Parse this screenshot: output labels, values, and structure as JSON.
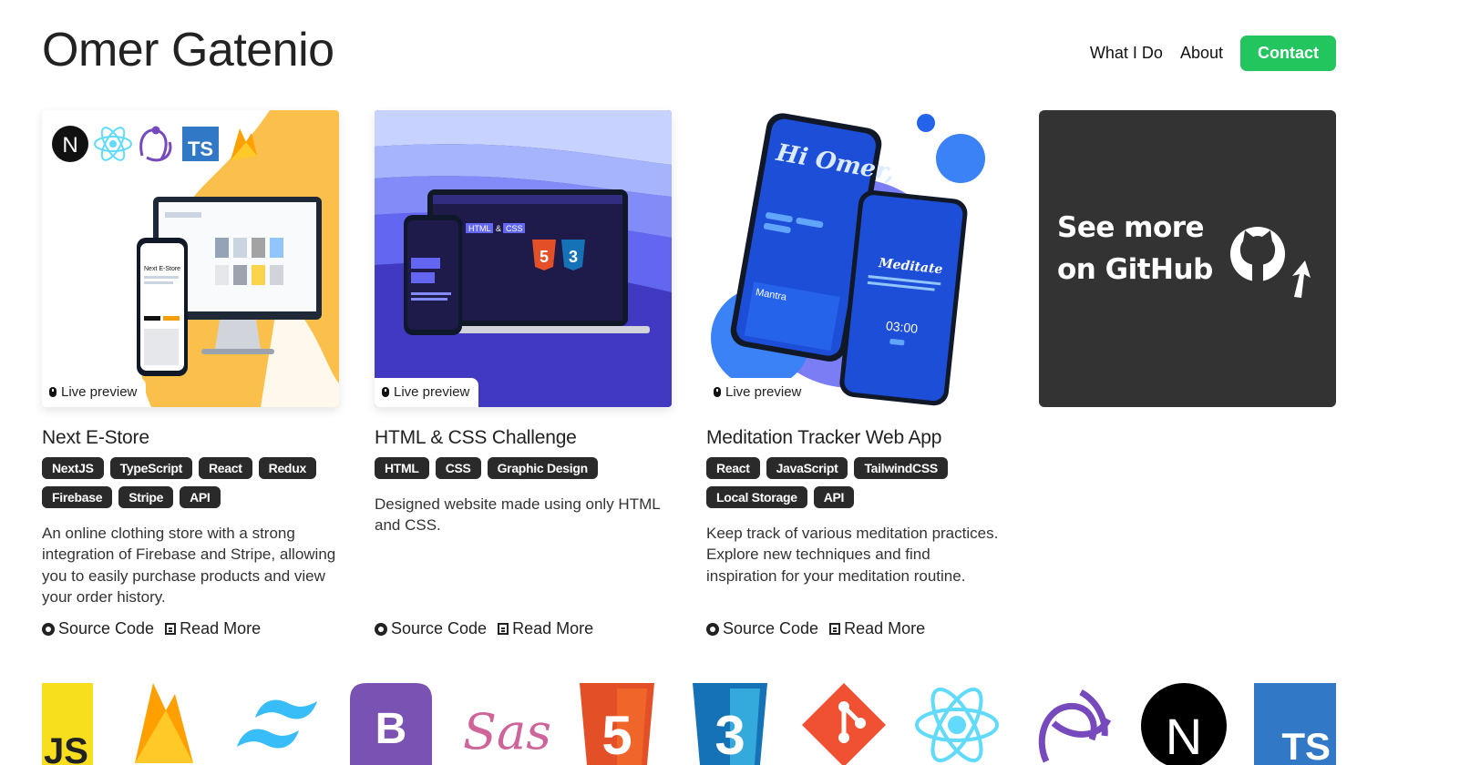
{
  "header": {
    "name": "Omer Gatenio",
    "nav": {
      "what_i_do": "What I Do",
      "about": "About",
      "contact": "Contact"
    }
  },
  "projects": [
    {
      "title": "Next E-Store",
      "live": "Live preview",
      "tags": [
        "NextJS",
        "TypeScript",
        "React",
        "Redux",
        "Firebase",
        "Stripe",
        "API"
      ],
      "description": "An online clothing store with a strong integration of Firebase and Stripe, allowing you to easily purchase products and view your order history.",
      "source": "Source Code",
      "read_more": "Read More",
      "logo_text": {
        "ts": "TS",
        "n": "N"
      },
      "screen_title": "Next E-Store"
    },
    {
      "title": "HTML & CSS Challenge",
      "live": "Live preview",
      "tags": [
        "HTML",
        "CSS",
        "Graphic Design"
      ],
      "description": "Designed website made using only HTML and CSS.",
      "source": "Source Code",
      "read_more": "Read More",
      "screen": {
        "html": "HTML",
        "amp": "&",
        "css": "CSS",
        "badge5": "5",
        "badge3": "3"
      }
    },
    {
      "title": "Meditation Tracker Web App",
      "live": "Live preview",
      "tags": [
        "React",
        "JavaScript",
        "TailwindCSS",
        "Local Storage",
        "API"
      ],
      "description": "Keep track of various meditation practices. Explore new techniques and find inspiration for your meditation routine.",
      "source": "Source Code",
      "read_more": "Read More",
      "screen": {
        "greeting": "Hi Omer,",
        "meditate": "Meditate",
        "mantra": "Mantra",
        "timer": "03:00"
      }
    }
  ],
  "github_card": {
    "line1": "See more",
    "line2": "on GitHub"
  },
  "tech_icons": [
    {
      "name": "javascript-icon",
      "label": "JS"
    },
    {
      "name": "firebase-icon",
      "label": ""
    },
    {
      "name": "tailwind-icon",
      "label": ""
    },
    {
      "name": "bootstrap-icon",
      "label": "B"
    },
    {
      "name": "sass-icon",
      "label": "Sass"
    },
    {
      "name": "html5-icon",
      "label": "5"
    },
    {
      "name": "css3-icon",
      "label": "3"
    },
    {
      "name": "git-icon",
      "label": ""
    },
    {
      "name": "react-icon",
      "label": ""
    },
    {
      "name": "redux-icon",
      "label": ""
    },
    {
      "name": "nextjs-icon",
      "label": "N"
    },
    {
      "name": "typescript-icon",
      "label": "TS"
    }
  ],
  "colors": {
    "contact": "#22c55e",
    "tag_bg": "#2a2a2a",
    "github_card": "#333333"
  }
}
